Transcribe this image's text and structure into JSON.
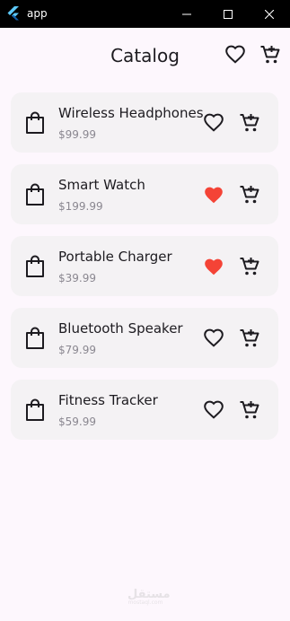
{
  "window": {
    "title": "app"
  },
  "appbar": {
    "title": "Catalog",
    "favorites_icon": "heart-outline-icon",
    "cart_icon": "shopping-cart-icon"
  },
  "products": [
    {
      "name": "Wireless Headphones",
      "price": "$99.99",
      "favorite": false
    },
    {
      "name": "Smart Watch",
      "price": "$199.99",
      "favorite": true
    },
    {
      "name": "Portable Charger",
      "price": "$39.99",
      "favorite": true
    },
    {
      "name": "Bluetooth Speaker",
      "price": "$79.99",
      "favorite": false
    },
    {
      "name": "Fitness Tracker",
      "price": "$59.99",
      "favorite": false
    }
  ],
  "colors": {
    "favorite_active": "#f44336",
    "icon": "#1d1b20",
    "card_background": "#f4f2f4",
    "page_background": "#fdf7fd"
  },
  "watermark": {
    "text": "مستقل",
    "subtext": "mostaql.com"
  }
}
